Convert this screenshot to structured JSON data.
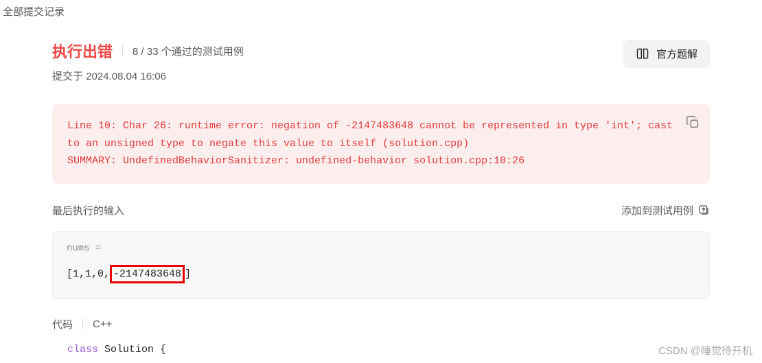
{
  "tab": {
    "label": "全部提交记录"
  },
  "header": {
    "status": "执行出错",
    "test_count": "8 / 33 个通过的测试用例",
    "submitted_prefix": "提交于",
    "submitted_time": "2024.08.04 16:06",
    "solution_btn": "官方题解"
  },
  "error": {
    "text": "Line 10: Char 26: runtime error: negation of -2147483648 cannot be represented in type 'int'; cast to an unsigned type to negate this value to itself (solution.cpp)\nSUMMARY: UndefinedBehaviorSanitizer: undefined-behavior solution.cpp:10:26"
  },
  "last_input": {
    "title": "最后执行的输入",
    "add_btn": "添加到测试用例",
    "var_label": "nums =",
    "value_prefix": "[1,1,0,",
    "value_highlight": "-2147483648",
    "value_suffix": "]"
  },
  "code": {
    "label": "代码",
    "lang": "C++",
    "snippet_kw": "class",
    "snippet_name": " Solution ",
    "snippet_brace": "{"
  },
  "watermark": "CSDN @睡觉待开机"
}
